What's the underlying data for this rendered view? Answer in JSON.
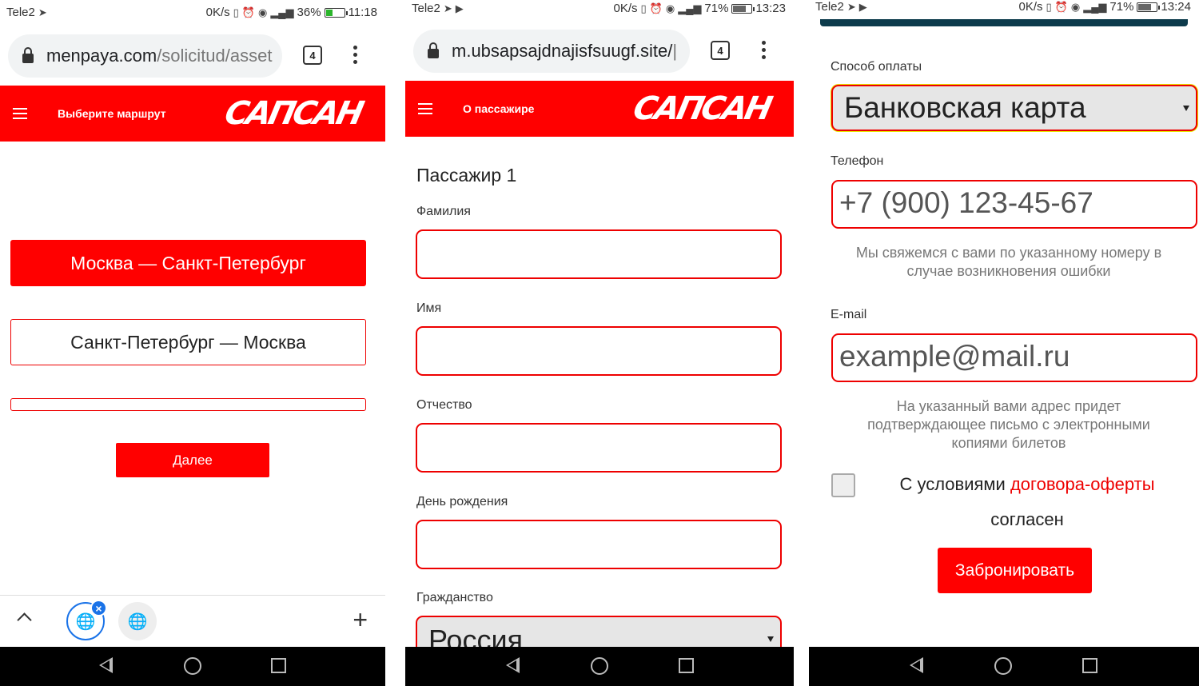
{
  "phone1": {
    "status": {
      "carrier": "Tele2",
      "speed": "0K/s",
      "battery": "36%",
      "battery_level": 0.36,
      "time": "11:18"
    },
    "browser": {
      "domain": "menpaya.com",
      "path": "/solicitud/asset",
      "tab_count": "4"
    },
    "header": {
      "title": "Выберите маршрут",
      "logo": "САПСАН"
    },
    "routes": [
      "Москва — Санкт-Петербург",
      "Санкт-Петербург — Москва"
    ],
    "next_label": "Далее",
    "tabs": {
      "close": "×",
      "new_tab": "+"
    }
  },
  "phone2": {
    "status": {
      "carrier": "Tele2",
      "speed": "0K/s",
      "battery": "71%",
      "battery_level": 0.71,
      "time": "13:23"
    },
    "browser": {
      "domain": "m.ubsapsajdnajisfsuugf.site/",
      "path": "|",
      "tab_count": "4"
    },
    "header": {
      "title": "О пассажире",
      "logo": "САПСАН"
    },
    "section_title": "Пассажир 1",
    "fields": {
      "surname": "Фамилия",
      "name": "Имя",
      "patronymic": "Отчество",
      "birthday": "День рождения",
      "citizenship": "Гражданство"
    },
    "citizenship_value": "Россия"
  },
  "phone3": {
    "status": {
      "carrier": "Tele2",
      "speed": "0K/s",
      "battery": "71%",
      "battery_level": 0.71,
      "time": "13:24"
    },
    "payment_label": "Способ оплаты",
    "payment_value": "Банковская карта",
    "phone_label": "Телефон",
    "phone_placeholder": "+7 (900) 123-45-67",
    "phone_hint": "Мы свяжемся с вами по указанному номеру в случае возникновения ошибки",
    "email_label": "E-mail",
    "email_placeholder": "example@mail.ru",
    "email_hint": "На указанный вами адрес придет подтверждающее письмо с электронными копиями билетов",
    "agree_prefix": "С условиями ",
    "agree_link": "договора-оферты",
    "agree_suffix": "согласен",
    "book_label": "Забронировать"
  },
  "colors": {
    "brand_red": "#ff0000",
    "accent_blue": "#1a73e8",
    "nav_black": "#000000"
  }
}
